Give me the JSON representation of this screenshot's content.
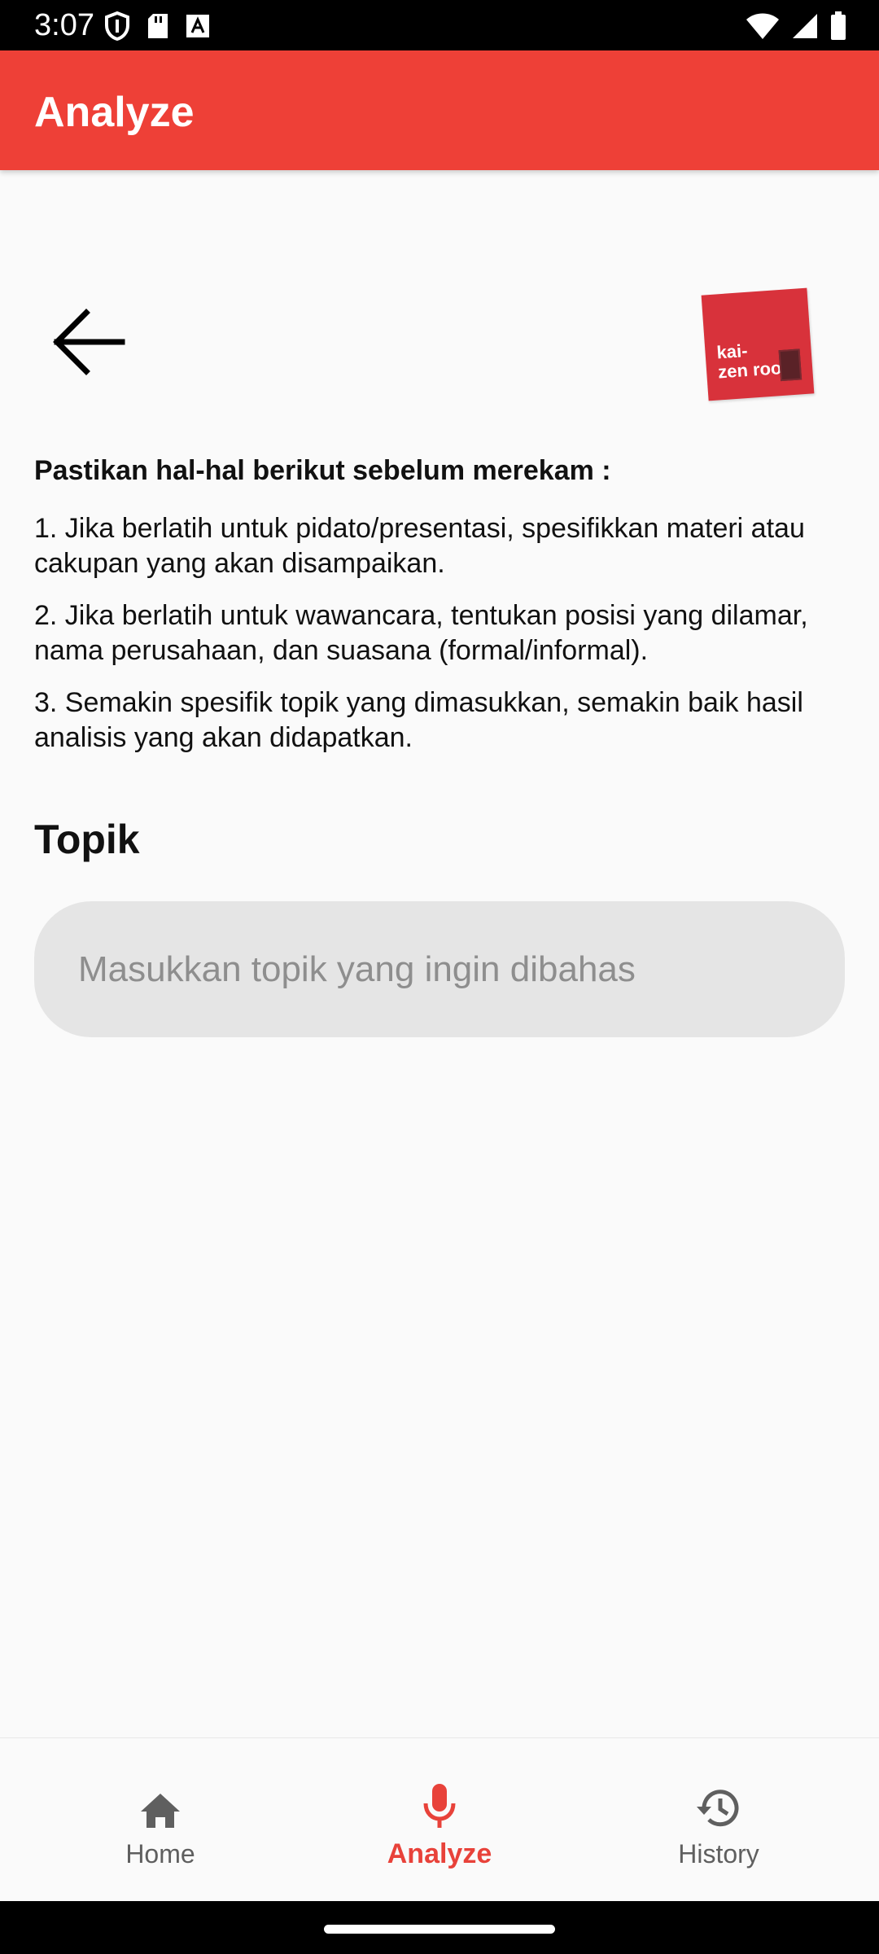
{
  "status_bar": {
    "time": "3:07",
    "left_icons": [
      "shield-icon",
      "sd-card-icon",
      "font-a-icon"
    ],
    "right_icons": [
      "wifi-icon",
      "signal-icon",
      "battery-icon"
    ]
  },
  "app_bar": {
    "title": "Analyze",
    "color": "#ee4037"
  },
  "content": {
    "back_icon": "arrow-left-icon",
    "logo_text": "kai-\nzen room",
    "instructions_title": "Pastikan hal-hal berikut sebelum merekam :",
    "instructions": [
      "1. Jika berlatih untuk pidato/presentasi, spesifikkan materi atau cakupan yang akan disampaikan.",
      "2. Jika berlatih untuk wawancara, tentukan posisi yang dilamar, nama perusahaan, dan suasana (formal/informal).",
      "3. Semakin spesifik topik yang dimasukkan, semakin baik hasil analisis yang akan didapatkan."
    ],
    "topic_heading": "Topik",
    "topic_input": {
      "placeholder": "Masukkan topik yang ingin dibahas",
      "value": ""
    }
  },
  "bottom_nav": {
    "active": "Analyze",
    "active_color": "#e8423a",
    "items": [
      {
        "label": "Home",
        "icon": "home-icon"
      },
      {
        "label": "Analyze",
        "icon": "microphone-icon"
      },
      {
        "label": "History",
        "icon": "history-icon"
      }
    ]
  }
}
